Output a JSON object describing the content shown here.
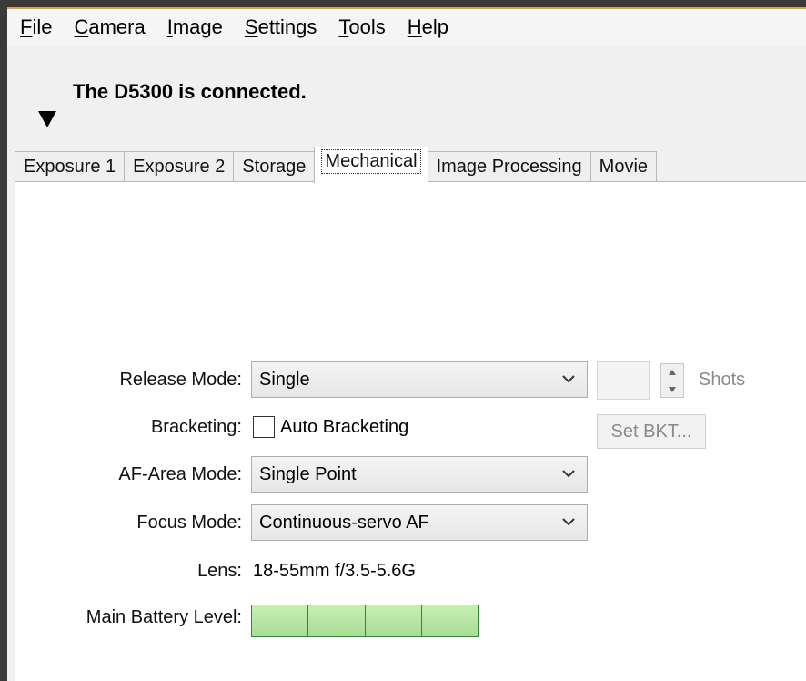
{
  "menu": {
    "items": [
      {
        "mnemonic": "F",
        "rest": "ile"
      },
      {
        "mnemonic": "C",
        "rest": "amera"
      },
      {
        "mnemonic": "I",
        "rest": "mage"
      },
      {
        "mnemonic": "S",
        "rest": "ettings"
      },
      {
        "mnemonic": "T",
        "rest": "ools"
      },
      {
        "mnemonic": "H",
        "rest": "elp"
      }
    ]
  },
  "status": {
    "message": "The D5300 is connected."
  },
  "tabs": [
    {
      "label": "Exposure 1",
      "active": false
    },
    {
      "label": "Exposure 2",
      "active": false
    },
    {
      "label": "Storage",
      "active": false
    },
    {
      "label": "Mechanical",
      "active": true
    },
    {
      "label": "Image Processing",
      "active": false
    },
    {
      "label": "Movie",
      "active": false
    }
  ],
  "form": {
    "release_mode": {
      "label": "Release Mode:",
      "value": "Single"
    },
    "shots": {
      "label": "Shots",
      "value": ""
    },
    "bracketing": {
      "label": "Bracketing:",
      "checkbox_label": "Auto Bracketing",
      "checked": false
    },
    "set_bkt": {
      "label": "Set BKT..."
    },
    "af_area_mode": {
      "label": "AF-Area Mode:",
      "value": "Single Point"
    },
    "focus_mode": {
      "label": "Focus Mode:",
      "value": "Continuous-servo AF"
    },
    "lens": {
      "label": "Lens:",
      "value": "18-55mm f/3.5-5.6G"
    },
    "battery": {
      "label": "Main Battery Level:",
      "segments_filled": 4,
      "segments_total": 4,
      "color": "#a8dd94"
    }
  },
  "icons": {
    "collapse": "triangle-down-icon",
    "dropdown": "chevron-down-icon",
    "spin_up": "triangle-up-icon",
    "spin_down": "triangle-down-icon"
  }
}
